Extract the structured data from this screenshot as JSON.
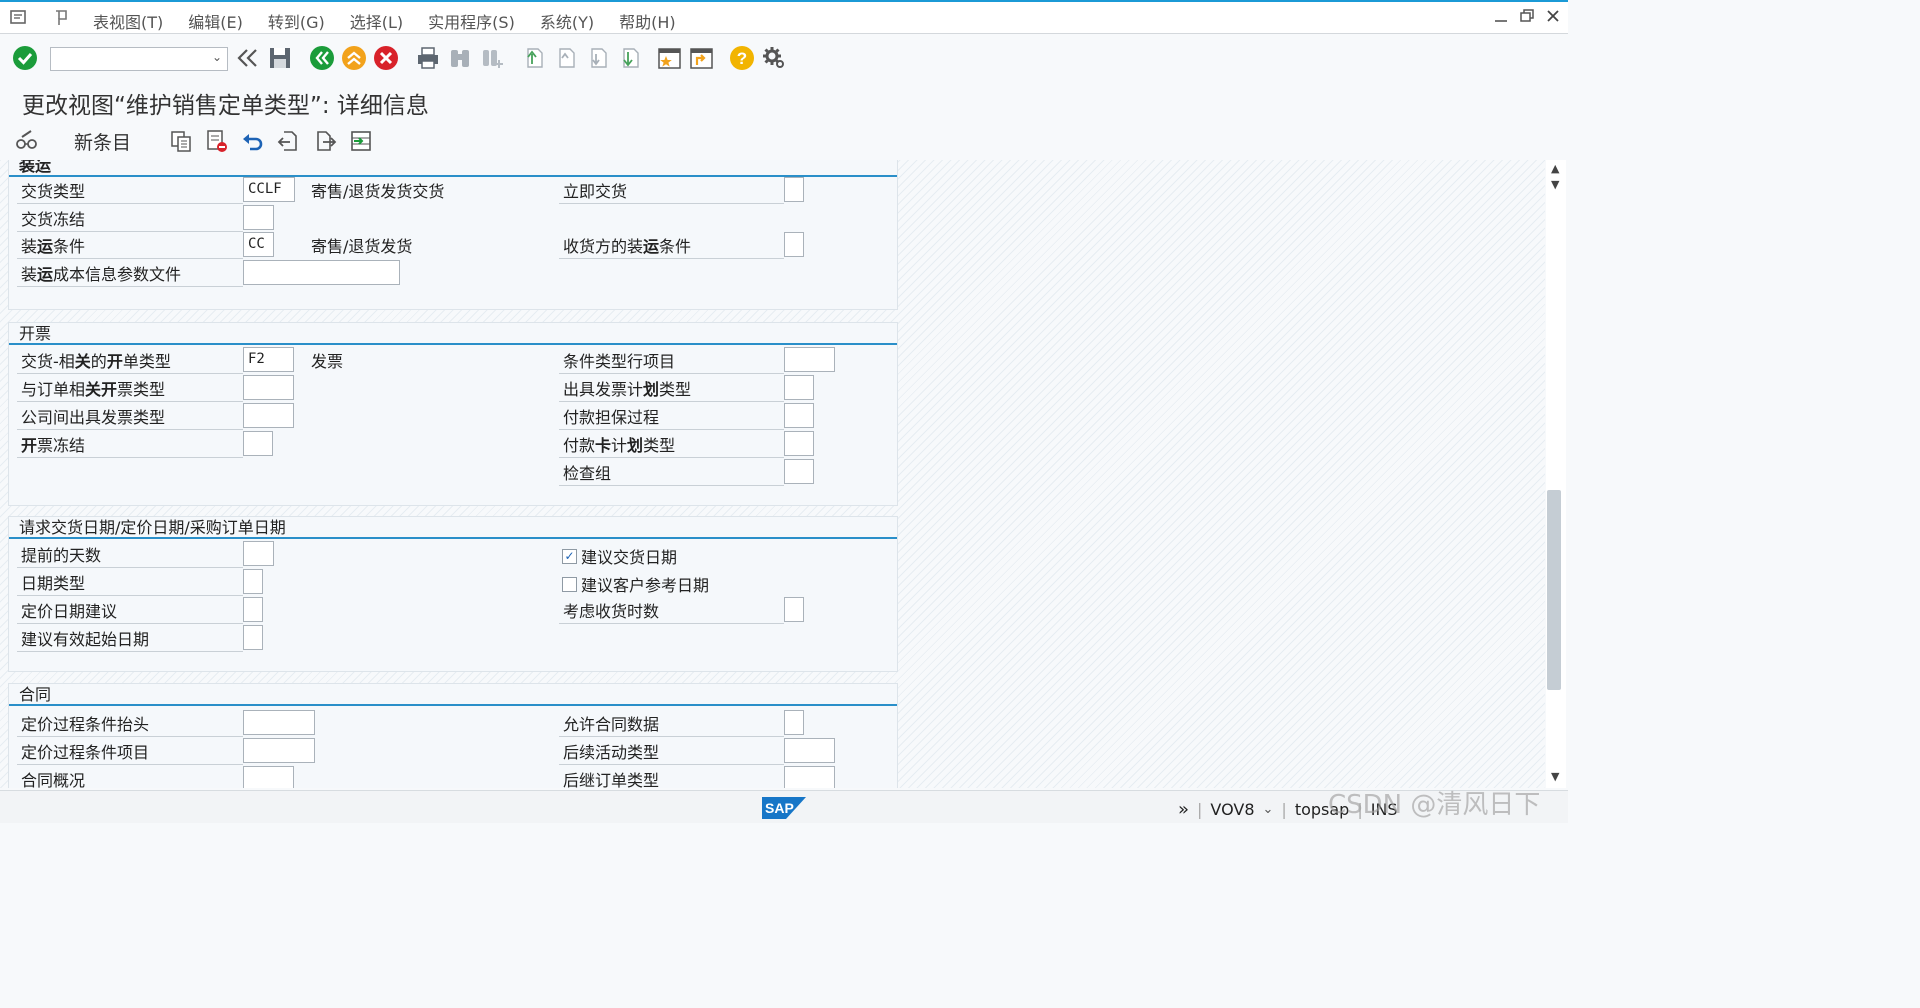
{
  "menu": {
    "items": [
      "表视图(T)",
      "编辑(E)",
      "转到(G)",
      "选择(L)",
      "实用程序(S)",
      "系统(Y)",
      "帮助(H)"
    ]
  },
  "title": {
    "prefix": "更改视图“维护销售定单类型”: 详细信息"
  },
  "app_toolbar": {
    "new_entry": "新条目"
  },
  "sections": {
    "shipping": {
      "title": "装运",
      "delivery_type_label": "交货类型",
      "delivery_type_value": "CCLF",
      "delivery_type_desc": "寄售/退货发货交货",
      "immediate_delivery_label": "立即交货",
      "delivery_block_label": "交货冻结",
      "shipping_cond_label": "装运条件",
      "shipping_cond_value": "CC",
      "shipping_cond_desc": "寄售/退货发货",
      "ship_to_cond_label": "收货方的装运条件",
      "shipping_cost_label": "装运成本信息参数文件"
    },
    "billing": {
      "title": "开票",
      "dlv_billing_label": "交货-相关的开单类型",
      "dlv_billing_value": "F2",
      "dlv_billing_desc": "发票",
      "order_billing_label": "与订单相关开票类型",
      "intercompany_label": "公司间出具发票类型",
      "billing_block_label": "开票冻结",
      "condition_type_label": "条件类型行项目",
      "billing_plan_label": "出具发票计划类型",
      "payment_guarantee_label": "付款担保过程",
      "payment_card_label": "付款卡计划类型",
      "check_group_label": "检查组"
    },
    "dates": {
      "title": "请求交货日期/定价日期/采购订单日期",
      "lead_time_label": "提前的天数",
      "date_type_label": "日期类型",
      "pricing_date_label": "定价日期建议",
      "valid_from_label": "建议有效起始日期",
      "propose_delivery_date_label": "建议交货日期",
      "propose_delivery_date_checked": true,
      "propose_po_date_label": "建议客户参考日期",
      "propose_po_date_checked": false,
      "lead_time_receipt_label": "考虑收货时数"
    },
    "contract": {
      "title": "合同",
      "pricing_header_label": "定价过程条件抬头",
      "pricing_item_label": "定价过程条件项目",
      "contract_profile_label": "合同概况",
      "allow_contract_data_label": "允许合同数据",
      "follow_up_activity_label": "后续活动类型",
      "subsequent_order_label": "后继订单类型"
    }
  },
  "status": {
    "transaction": "VOV8",
    "user": "topsap",
    "mode": "INS"
  },
  "watermark": "CSDN @清风日下",
  "colors": {
    "accent": "#2a8fc9",
    "ok": "#1b9c3a",
    "cancel": "#d8222a",
    "back": "#1b9c3a",
    "exit": "#f2a21b"
  }
}
